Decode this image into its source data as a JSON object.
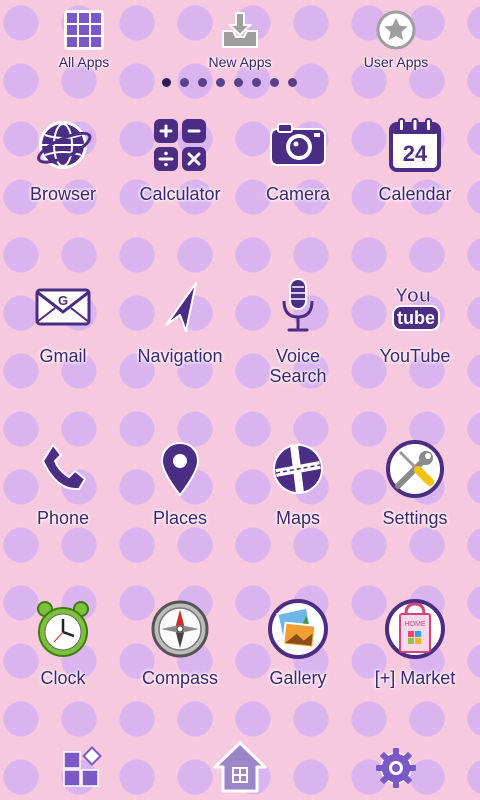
{
  "top_bar": {
    "all_apps": "All Apps",
    "new_apps": "New Apps",
    "user_apps": "User Apps"
  },
  "page_indicator": {
    "count": 8,
    "active": 1
  },
  "apps": [
    {
      "label": "Browser",
      "icon": "globe-icon"
    },
    {
      "label": "Calculator",
      "icon": "calculator-icon"
    },
    {
      "label": "Camera",
      "icon": "camera-icon"
    },
    {
      "label": "Calendar",
      "icon": "calendar-icon",
      "date": "24"
    },
    {
      "label": "Gmail",
      "icon": "gmail-envelope-icon"
    },
    {
      "label": "Navigation",
      "icon": "navigation-arrow-icon"
    },
    {
      "label": "Voice\nSearch",
      "icon": "microphone-icon"
    },
    {
      "label": "YouTube",
      "icon": "youtube-icon",
      "logo_top": "You",
      "logo_bottom": "tube"
    },
    {
      "label": "Phone",
      "icon": "phone-handset-icon"
    },
    {
      "label": "Places",
      "icon": "map-pin-icon"
    },
    {
      "label": "Maps",
      "icon": "map-road-icon"
    },
    {
      "label": "Settings",
      "icon": "wrench-screwdriver-icon"
    },
    {
      "label": "Clock",
      "icon": "alarm-clock-icon"
    },
    {
      "label": "Compass",
      "icon": "compass-icon"
    },
    {
      "label": "Gallery",
      "icon": "gallery-photos-icon"
    },
    {
      "label": "[+] Market",
      "icon": "shopping-bag-icon",
      "bag_text": "HOME"
    }
  ],
  "dock": [
    "widgets-icon",
    "home-house-icon",
    "gear-icon"
  ],
  "colors": {
    "background": "#f7c9de",
    "polka_dot": "#d9b4ef",
    "icon_purple": "#4b2d83",
    "label_text": "#3e2670"
  }
}
